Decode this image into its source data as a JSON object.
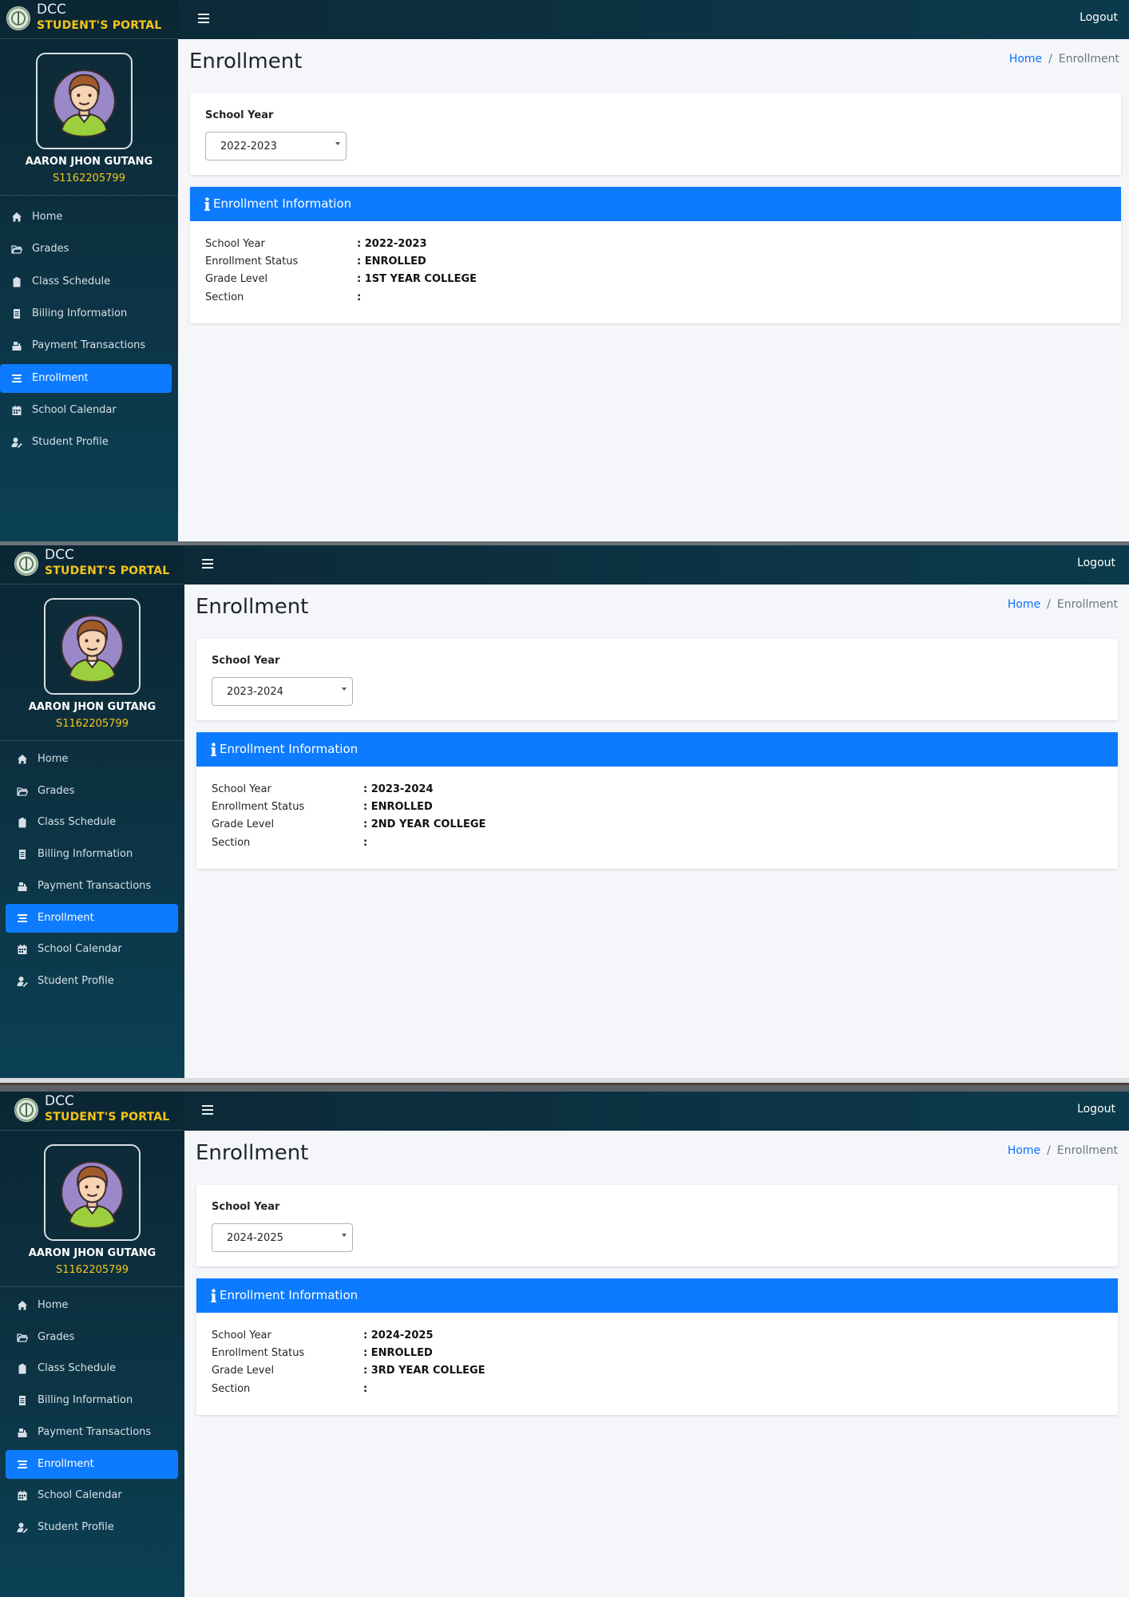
{
  "brand": {
    "title": "DCC",
    "subtitle": "STUDENT'S PORTAL"
  },
  "user": {
    "name": "AARON JHON GUTANG",
    "id": "S1162205799"
  },
  "topbar": {
    "logout_label": "Logout"
  },
  "page": {
    "title": "Enrollment"
  },
  "breadcrumb": {
    "home": "Home",
    "separator": "/",
    "current": "Enrollment"
  },
  "nav": [
    {
      "label": "Home",
      "icon": "home-icon"
    },
    {
      "label": "Grades",
      "icon": "folder-open-icon"
    },
    {
      "label": "Class Schedule",
      "icon": "clipboard-icon"
    },
    {
      "label": "Billing Information",
      "icon": "document-icon"
    },
    {
      "label": "Payment Transactions",
      "icon": "cash-register-icon"
    },
    {
      "label": "Enrollment",
      "icon": "list-icon",
      "active": true
    },
    {
      "label": "School Calendar",
      "icon": "calendar-icon"
    },
    {
      "label": "Student Profile",
      "icon": "user-edit-icon"
    }
  ],
  "form": {
    "school_year_label": "School Year"
  },
  "info": {
    "header": "Enrollment Information",
    "labels": {
      "school_year": "School Year",
      "status": "Enrollment Status",
      "grade_level": "Grade Level",
      "section": "Section"
    }
  },
  "panels": [
    {
      "selected_year": "2022-2023",
      "school_year": ": 2022-2023",
      "status": ": ENROLLED",
      "grade_level": ": 1ST YEAR COLLEGE",
      "section": ":"
    },
    {
      "selected_year": "2023-2024",
      "school_year": ": 2023-2024",
      "status": ": ENROLLED",
      "grade_level": ": 2ND YEAR COLLEGE",
      "section": ":"
    },
    {
      "selected_year": "2024-2025",
      "school_year": ": 2024-2025",
      "status": ": ENROLLED",
      "grade_level": ": 3RD YEAR COLLEGE",
      "section": ":"
    }
  ],
  "colors": {
    "accent": "#0d7bff",
    "brand_yellow": "#f5c518",
    "sidebar_dark": "#0b2633"
  }
}
